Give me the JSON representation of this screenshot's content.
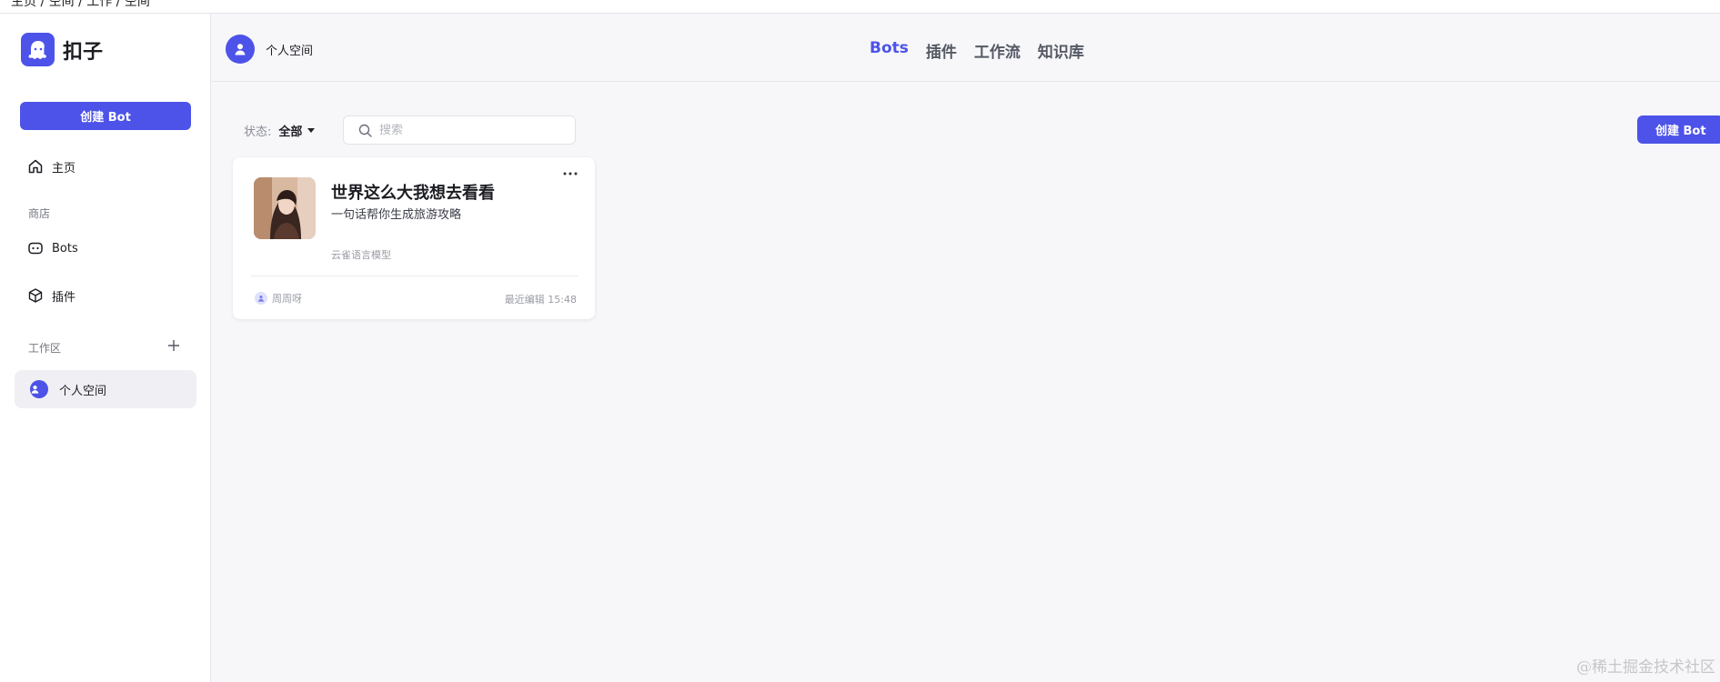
{
  "top_strip": {
    "text": "主页 / 空间 / 工作 / 空间"
  },
  "brand": {
    "name": "扣子",
    "logo_icon": "ghost-logo-icon",
    "color": "#4d53e8"
  },
  "sidebar": {
    "create_label": "创建 Bot",
    "home_label": "主页",
    "store_section": "商店",
    "store_items": [
      {
        "label": "Bots",
        "icon": "bot-face-icon"
      },
      {
        "label": "插件",
        "icon": "cube-icon"
      }
    ],
    "workspace_section": "工作区",
    "workspace_item": "个人空间"
  },
  "header": {
    "space_name": "个人空间",
    "tabs": [
      {
        "label": "Bots",
        "active": true
      },
      {
        "label": "插件",
        "active": false
      },
      {
        "label": "工作流",
        "active": false
      },
      {
        "label": "知识库",
        "active": false
      }
    ]
  },
  "filters": {
    "status_label": "状态:",
    "status_value": "全部",
    "search_placeholder": "搜索",
    "create_label": "创建 Bot"
  },
  "bots": [
    {
      "name": "世界这么大我想去看看",
      "description": "一句话帮你生成旅游攻略",
      "model": "云雀语言模型",
      "author": "周周呀",
      "edited": "最近编辑 15:48"
    }
  ],
  "watermark": "@稀土掘金技术社区",
  "colors": {
    "accent": "#4d53e8",
    "background": "#f7f7fa"
  }
}
